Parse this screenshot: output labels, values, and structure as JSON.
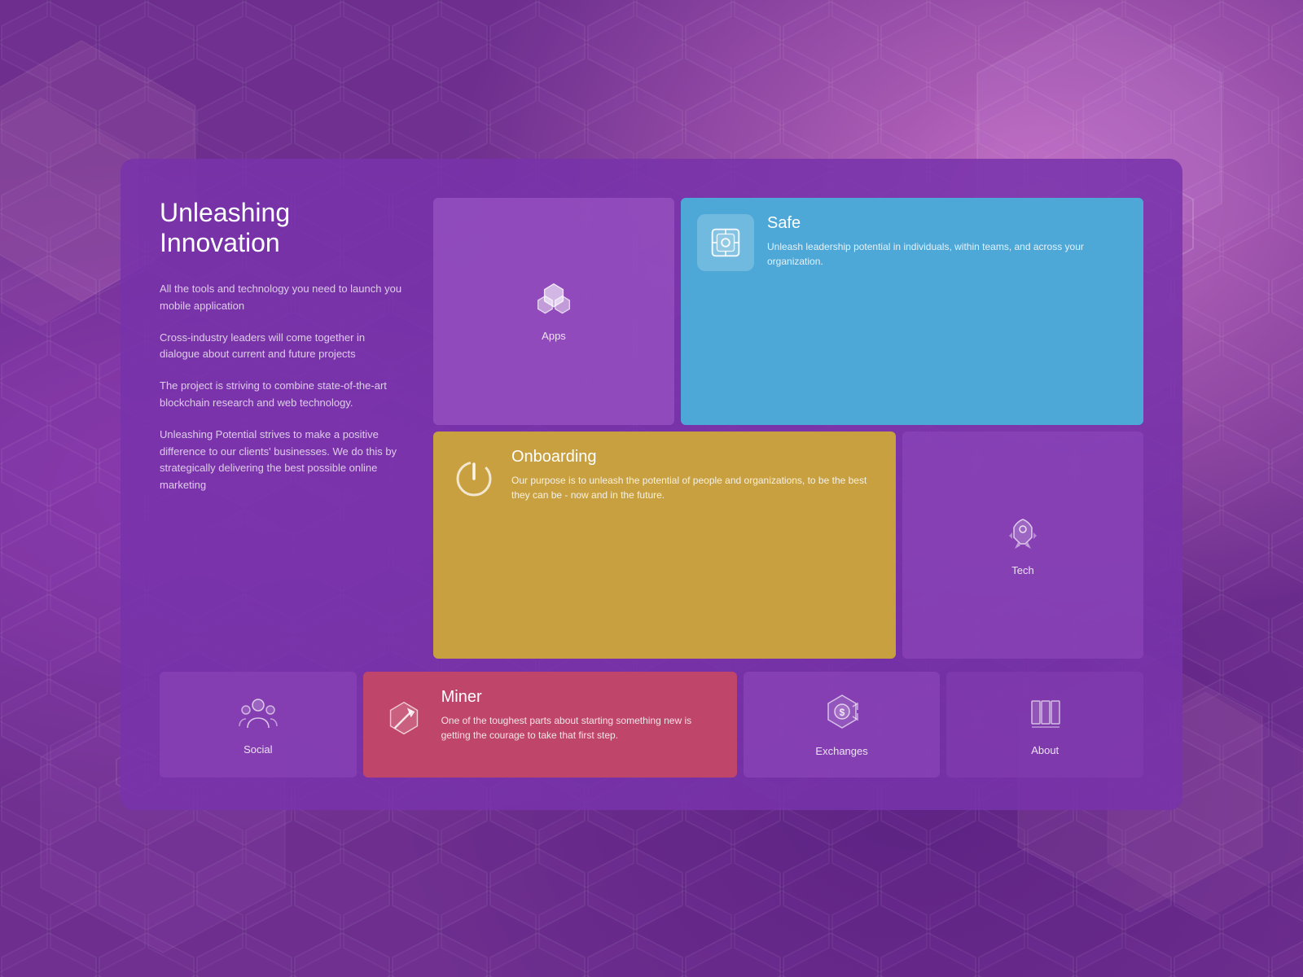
{
  "background": {
    "color": "#6b2d8b"
  },
  "card": {
    "title": "Unleashing Innovation",
    "intro_paragraphs": [
      "All the tools and technology you need to launch you mobile application",
      "Cross-industry leaders will come together in dialogue about current and future projects",
      "The project is striving to combine state-of-the-art blockchain research and web technology.",
      "Unleashing Potential strives to make a positive difference to our clients' businesses. We do this by strategically delivering the best possible online marketing"
    ]
  },
  "tiles": {
    "apps": {
      "label": "Apps"
    },
    "safe": {
      "title": "Safe",
      "description": "Unleash leadership potential in individuals, within teams, and across your organization."
    },
    "onboarding": {
      "title": "Onboarding",
      "description": "Our purpose is to unleash the potential of people and organizations, to be the best they can be - now and in the future."
    },
    "tech": {
      "label": "Tech"
    },
    "social": {
      "label": "Social"
    },
    "miner": {
      "title": "Miner",
      "description": "One of the toughest parts about starting something new is getting the courage to take that first step."
    },
    "exchanges": {
      "label": "Exchanges"
    },
    "about": {
      "label": "About"
    }
  }
}
